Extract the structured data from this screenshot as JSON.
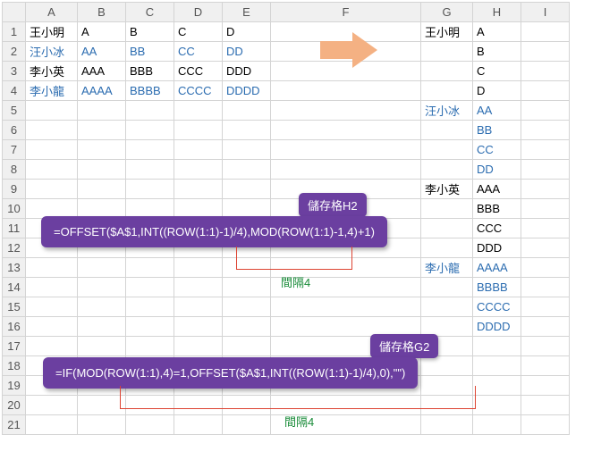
{
  "columns": [
    "A",
    "B",
    "C",
    "D",
    "E",
    "F",
    "G",
    "H",
    "I"
  ],
  "rows": [
    {
      "n": "1",
      "A": "王小明",
      "B": "A",
      "C": "B",
      "D": "C",
      "E": "D",
      "G": "王小明",
      "H": "A"
    },
    {
      "n": "2",
      "A": "汪小冰",
      "B": "AA",
      "C": "BB",
      "D": "CC",
      "E": "DD",
      "H": "B",
      "blueA": true,
      "blueBE": true
    },
    {
      "n": "3",
      "A": "李小英",
      "B": "AAA",
      "C": "BBB",
      "D": "CCC",
      "E": "DDD",
      "H": "C"
    },
    {
      "n": "4",
      "A": "李小龍",
      "B": "AAAA",
      "C": "BBBB",
      "D": "CCCC",
      "E": "DDDD",
      "H": "D",
      "blueA": true,
      "blueBE": true
    },
    {
      "n": "5",
      "G": "汪小冰",
      "H": "AA",
      "blueG": true,
      "blueH": true
    },
    {
      "n": "6",
      "H": "BB",
      "blueH": true
    },
    {
      "n": "7",
      "H": "CC",
      "blueH": true
    },
    {
      "n": "8",
      "H": "DD",
      "blueH": true
    },
    {
      "n": "9",
      "G": "李小英",
      "H": "AAA"
    },
    {
      "n": "10",
      "H": "BBB"
    },
    {
      "n": "11",
      "H": "CCC"
    },
    {
      "n": "12",
      "H": "DDD"
    },
    {
      "n": "13",
      "G": "李小龍",
      "H": "AAAA",
      "blueG": true,
      "blueH": true
    },
    {
      "n": "14",
      "H": "BBBB",
      "blueH": true
    },
    {
      "n": "15",
      "H": "CCCC",
      "blueH": true
    },
    {
      "n": "16",
      "H": "DDDD",
      "blueH": true
    },
    {
      "n": "17"
    },
    {
      "n": "18"
    },
    {
      "n": "19"
    },
    {
      "n": "20"
    },
    {
      "n": "21"
    }
  ],
  "callout1": {
    "tag": "儲存格H2",
    "formula": "=OFFSET($A$1,INT((ROW(1:1)-1)/4),MOD(ROW(1:1)-1,4)+1)",
    "label": "間隔4"
  },
  "callout2": {
    "tag": "儲存格G2",
    "formula": "=IF(MOD(ROW(1:1),4)=1,OFFSET($A$1,INT((ROW(1:1)-1)/4),0),\"\")",
    "label": "間隔4"
  }
}
